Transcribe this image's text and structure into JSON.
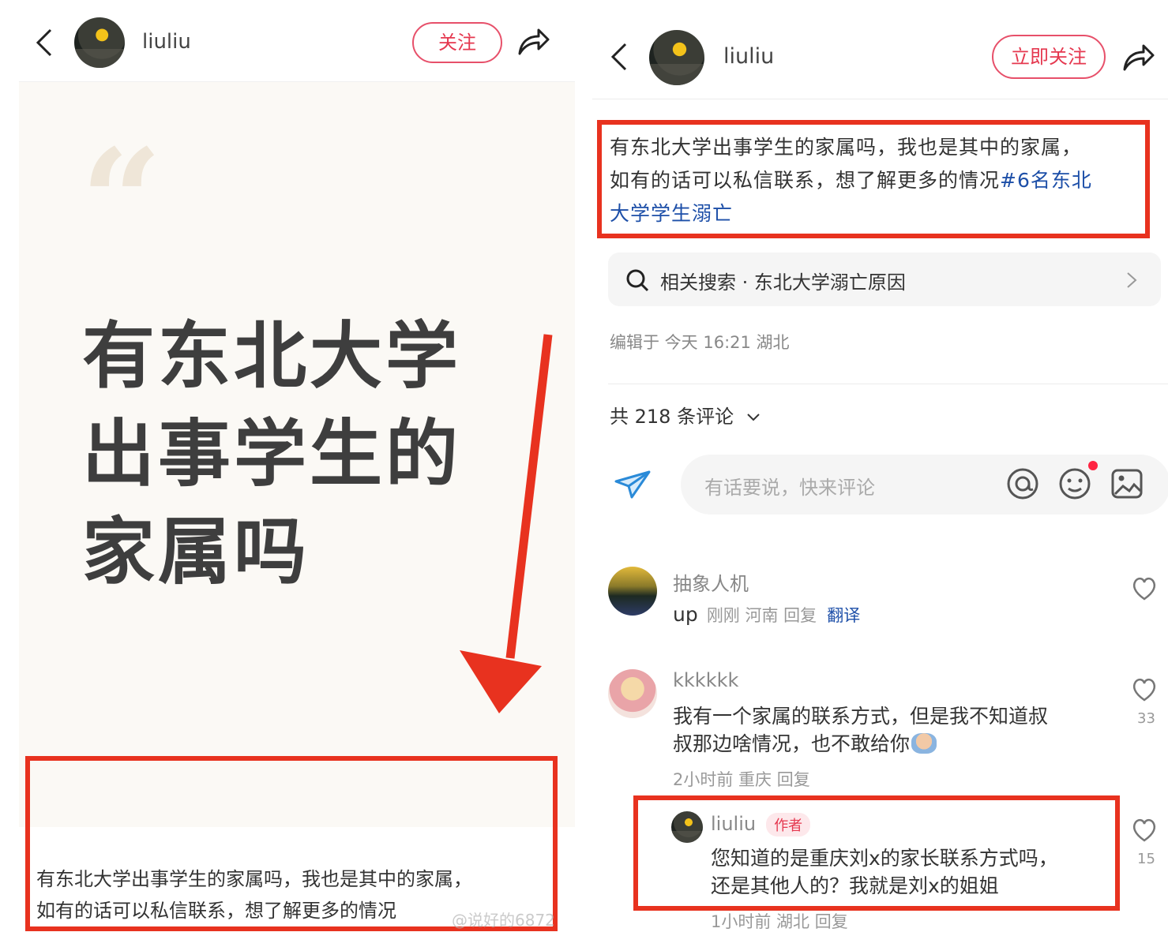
{
  "left": {
    "username": "liuliu",
    "follow_label": "关注",
    "quote_mark": "“",
    "title_lines": [
      "有东北大学",
      "出事学生的",
      "家属吗"
    ],
    "caption_line1": "有东北大学出事学生的家属吗，我也是其中的家属，",
    "caption_line2": "如有的话可以私信联系，想了解更多的情况",
    "watermark": "@说好的6872"
  },
  "right": {
    "username": "liuliu",
    "follow_label": "立即关注",
    "post_text_line1": "有东北大学出事学生的家属吗，我也是其中的家属，",
    "post_text_line2_plain": "如有的话可以私信联系，想了解更多的情况",
    "post_text_hashtag_a": "#6名东北",
    "post_text_hashtag_b": "大学学生溺亡",
    "related_search": "相关搜索 · 东北大学溺亡原因",
    "edit_meta": "编辑于 今天 16:21 湖北",
    "comment_count": "共 218 条评论",
    "comment_placeholder": "有话要说，快来评论",
    "comments": [
      {
        "name": "抽象人机",
        "body": "up",
        "meta": "刚刚 河南 回复",
        "translate": "翻译"
      },
      {
        "name": "kkkkkk",
        "body_line1": "我有一个家属的联系方式，但是我不知道叔",
        "body_line2": "叔那边啥情况，也不敢给你",
        "meta": "2小时前 重庆 回复",
        "likes": "33"
      }
    ],
    "reply": {
      "name": "liuliu",
      "tag": "作者",
      "body_line1": "您知道的是重庆刘x的家长联系方式吗，",
      "body_line2": "还是其他人的？我就是刘x的姐姐",
      "meta": "1小时前 湖北 回复",
      "likes": "15"
    }
  },
  "colors": {
    "accent_red": "#e8321f",
    "follow_pink": "#e5384f",
    "hashtag_blue": "#1d4fa8",
    "card_bg": "#fbf9f5"
  }
}
